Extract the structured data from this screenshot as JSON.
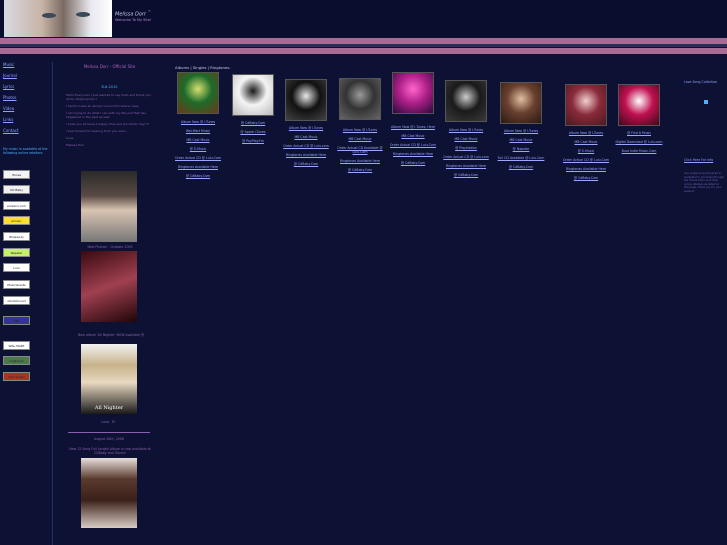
{
  "header": {
    "site_title": "Melissa Dorr",
    "title_mark": "™",
    "tagline": "Welcome To My Site!"
  },
  "nav": {
    "items": [
      "Music",
      "Journal",
      "Lyrics",
      "Photos",
      "Video",
      "Links",
      "Contact"
    ],
    "note": "My music is available at the following online retailers:"
  },
  "retailers": [
    {
      "name": "iTunes",
      "icon": "itunes-icon",
      "bg": "#f4f4f4"
    },
    {
      "name": "CD Baby",
      "icon": "cdbaby-icon",
      "bg": "#f0f0f0"
    },
    {
      "name": "amazon.com",
      "icon": "amazon-icon",
      "bg": "#ffffff"
    },
    {
      "name": "emusic",
      "icon": "emusic-icon",
      "bg": "#ffdd33"
    },
    {
      "name": "Rhapsody",
      "icon": "rhapsody-icon",
      "bg": "#ffffff"
    },
    {
      "name": "Napster",
      "icon": "napster-icon",
      "bg": "#c6f070"
    },
    {
      "name": "Lulu",
      "icon": "lulu-icon",
      "bg": "#ffffff"
    },
    {
      "name": "MusicGiants",
      "icon": "musicgiants-icon",
      "bg": "#ffffff"
    },
    {
      "name": "shockhound",
      "icon": "shockhound-icon",
      "bg": "#ffffff"
    },
    {
      "name": "FYE",
      "icon": "fye-icon",
      "bg": "#333399"
    },
    {
      "name": "WAL-MART",
      "icon": "walmart-icon",
      "bg": "#ffffff"
    },
    {
      "name": "ringtones",
      "icon": "ringtones-icon",
      "bg": "#4a7a4a"
    },
    {
      "name": "mp3 music",
      "icon": "mp3-icon",
      "bg": "#aa3322"
    },
    {
      "name": "YouTube",
      "icon": "youtube-icon",
      "bg": "#ffffff"
    }
  ],
  "center": {
    "heading": "Melissa Dorr - Official Site",
    "date": "8-6-2010",
    "blurbs": [
      "Hello Everyone! I just wanted to say hello and thank you all for stopping by!!!",
      "I had to make an abrupt move from where I was.",
      "I am trying to do what I can with my life and that has happened in the past as well.",
      "I hope you all have a happy time and wonderful day!!!!",
      "I look forward to hearing from you soon...",
      "Love,",
      "Melissa Dorr"
    ],
    "caption1": "New Photos! - October 2009",
    "caption2": "New album 'All Nighter' NOW available @",
    "album_art_text": "All Nighter",
    "sign_off": "Love,  M",
    "date2": "August 28th, 2008",
    "caption3": "New 12 Song Full Length Album is now available at CDBaby and iTunes!"
  },
  "albums_label": "Albums | Singles | Ringtones:",
  "albums": [
    {
      "links": [
        "Album Now @ I-Tunes",
        "Wal-Mart Music",
        "MB Cast Music",
        "@ E-Music",
        "Order Actual CD @ Lulu.Com",
        "Ringtones Available Here",
        "@ CdBaby.Com"
      ],
      "colors": [
        "#1d6b2a",
        "#d6e070",
        "#6a3a1a"
      ]
    },
    {
      "links": [
        "@ CdBaby.Com",
        "@ Apple I-Tunes",
        "@ PayPlay.Fm"
      ],
      "colors": [
        "#f4f4f4",
        "#1a1a1a",
        "#bbbbbb"
      ]
    },
    {
      "links": [
        "Album Now @ I-Tunes",
        "MB Cast Music",
        "Order Actual CD @ Lulu.com",
        "Ringtones Available Here",
        "@ CdBaby.Com"
      ],
      "colors": [
        "#111111",
        "#e8e8e8",
        "#444444"
      ]
    },
    {
      "links": [
        "Album Now @ I-Tunes",
        "MB Cast Music",
        "Order Actual CD Available @ Lulu.Com",
        "Ringtones Available Here",
        "@ CdBaby.Com"
      ],
      "colors": [
        "#333333",
        "#9a9a9a",
        "#666666"
      ]
    },
    {
      "links": [
        "Album Now @ I-Tunes, Here",
        "MB Cast Music",
        "Order Actual CD @ Lulu.Com",
        "Ringtones Available Here",
        "@ CdBaby.Com"
      ],
      "colors": [
        "#b0208a",
        "#ff66cc",
        "#2a0a3a"
      ]
    },
    {
      "links": [
        "Album Now @ I-Tunes",
        "MB Cast Music",
        "@ Playstation",
        "Order Actual CD @ Lulu.com",
        "Ringtones Available Here",
        "@ CdBaby.Com"
      ],
      "colors": [
        "#1a1a1a",
        "#cccccc",
        "#3a3a3a"
      ]
    },
    {
      "links": [
        "Album Now @ I-Tunes",
        "MB Cast Music",
        "@ Napster",
        "Full CD Available @ Lulu.Com",
        "@ CdBaby.Com"
      ],
      "colors": [
        "#6a4030",
        "#e0c0a0",
        "#2a1a10"
      ]
    },
    {
      "links": [
        "Album Now @ I-Tunes",
        "MB Cast Music",
        "@ E-Music",
        "Order Actual CD @ Lulu.Com",
        "Ringtones Available Here",
        "@ CdBaby.Com"
      ],
      "colors": [
        "#8a2a3a",
        "#f0d0d0",
        "#4a1a20"
      ]
    },
    {
      "links": [
        "@ Find It Music",
        "Digital Download @ Lulu.com",
        "Buzz Indie Music.Com"
      ],
      "colors": [
        "#c01050",
        "#ffffff",
        "#3a0a1a"
      ]
    }
  ],
  "right": {
    "label": "Love Song Collection",
    "link": "Click Here For Info",
    "fine": "Any single song download is available for purchase through the iTunes Store and other online retailers as listed on this page, thank you for your support."
  }
}
